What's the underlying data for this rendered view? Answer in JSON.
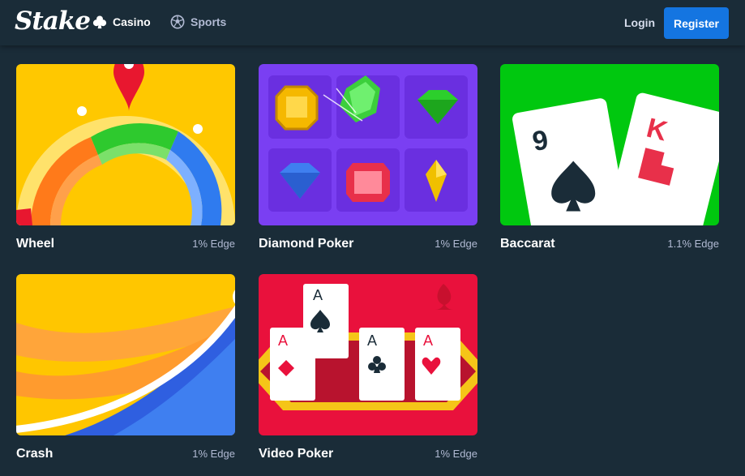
{
  "header": {
    "logo": "Stake",
    "nav": [
      {
        "label": "Casino",
        "icon": "club-icon"
      },
      {
        "label": "Sports",
        "icon": "soccer-ball-icon"
      }
    ],
    "login_label": "Login",
    "register_label": "Register"
  },
  "games": [
    {
      "name": "Wheel",
      "edge": "1% Edge",
      "bg": "#ffc800"
    },
    {
      "name": "Diamond Poker",
      "edge": "1% Edge",
      "bg": "#7a3ff2"
    },
    {
      "name": "Baccarat",
      "edge": "1.1% Edge",
      "bg": "#00c80f"
    },
    {
      "name": "Crash",
      "edge": "1% Edge",
      "bg": "#ffc600"
    },
    {
      "name": "Video Poker",
      "edge": "1% Edge",
      "bg": "#e9113c"
    }
  ],
  "card_art": {
    "baccarat_cards": [
      "9",
      "K"
    ],
    "video_poker_cards": [
      "A",
      "A",
      "A",
      "A"
    ]
  },
  "colors": {
    "background": "#1a2c38",
    "accent": "#1475e1",
    "muted_text": "#b1bad3"
  }
}
